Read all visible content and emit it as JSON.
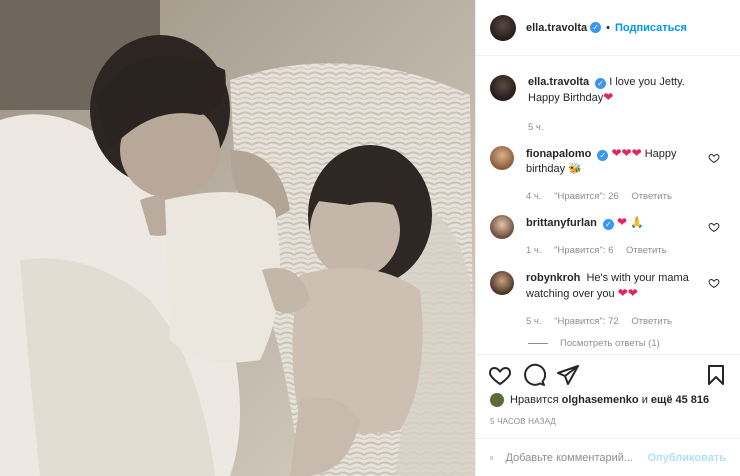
{
  "header": {
    "username": "ella.travolta",
    "separator": "•",
    "follow_label": "Подписаться"
  },
  "caption": {
    "username": "ella.travolta",
    "text": "I love you Jetty. Happy Birthday",
    "emoji": "❤",
    "time": "5 ч."
  },
  "comments": [
    {
      "username": "fionapalomo",
      "verified": true,
      "emojis": "❤❤❤",
      "text": "Happy birthday",
      "trailing_emoji": "🐝",
      "time": "4 ч.",
      "likes": "\"Нравится\": 26",
      "reply": "Ответить"
    },
    {
      "username": "brittanyfurlan",
      "verified": true,
      "emojis": "❤",
      "trailing_emoji": "🙏",
      "time": "1 ч.",
      "likes": "\"Нравится\": 6",
      "reply": "Ответить"
    },
    {
      "username": "robynkroh",
      "verified": false,
      "text": "He's with your mama watching over you",
      "emojis": "❤❤",
      "time": "5 ч.",
      "likes": "\"Нравится\": 72",
      "reply": "Ответить"
    }
  ],
  "view_replies": "Посмотреть ответы (1)",
  "likes": {
    "prefix": "Нравится",
    "user": "olghasemenko",
    "middle": "и",
    "count_text": "ещё 45 816"
  },
  "timestamp": "5 ЧАСОВ НАЗАД",
  "add_comment": {
    "placeholder": "Добавьте комментарий...",
    "post_label": "Опубликовать"
  },
  "colors": {
    "accent": "#0095f6",
    "verified": "#3897f0",
    "heart": "#e0245e",
    "muted": "#8e8e8e"
  },
  "icons": [
    "heart-icon",
    "comment-icon",
    "share-icon",
    "bookmark-icon",
    "emoji-icon",
    "verified-icon"
  ]
}
